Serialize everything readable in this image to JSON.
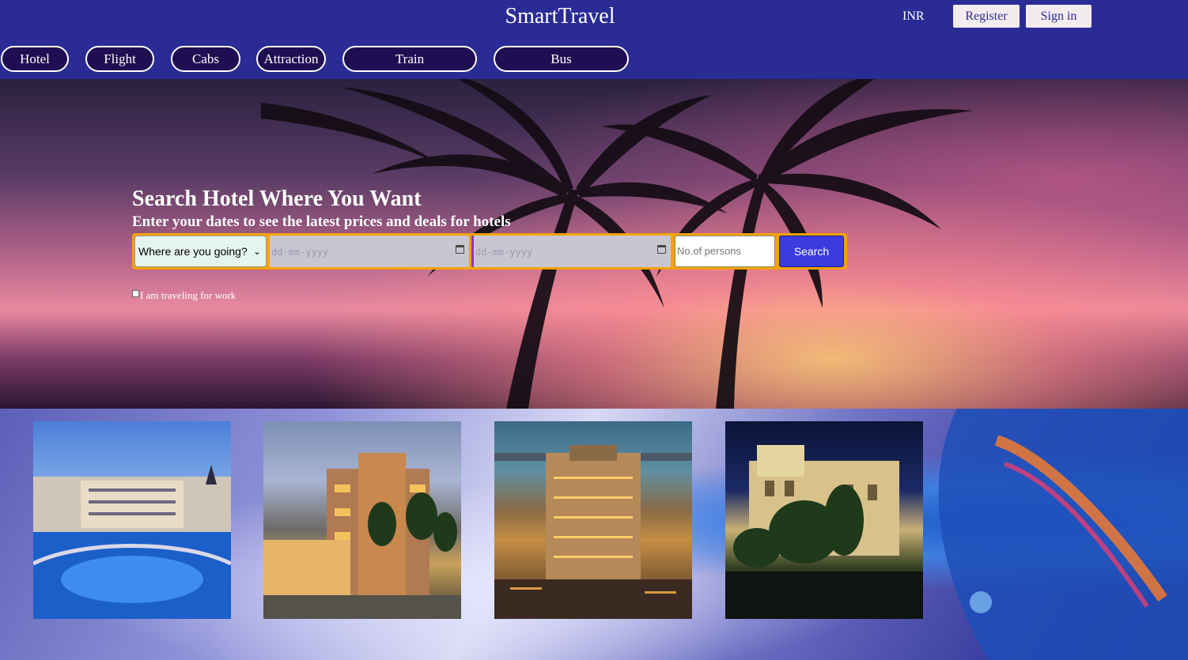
{
  "header": {
    "brand": "SmartTravel",
    "currency": "INR",
    "register_label": "Register",
    "signin_label": "Sign in"
  },
  "nav": {
    "items": [
      {
        "label": "Hotel"
      },
      {
        "label": "Flight"
      },
      {
        "label": "Cabs"
      },
      {
        "label": "Attraction"
      },
      {
        "label": "Train"
      },
      {
        "label": "Bus"
      }
    ]
  },
  "hero": {
    "title": "Search Hotel Where You Want",
    "subtitle": "Enter your dates to see the latest prices and deals for hotels"
  },
  "search": {
    "destination_value": "Where are you going?",
    "checkin_placeholder": "dd-mm-yyyy",
    "checkout_placeholder": "dd-mm-yyyy",
    "persons_placeholder": "No.of persons",
    "button_label": "Search",
    "work_checkbox_label": "I am traveling for work",
    "work_checked": false
  },
  "colors": {
    "header_bg": "#2b2b96",
    "search_border": "#f4a300",
    "search_button": "#3b3be0",
    "nav_pill_bg": "#1f0f52"
  },
  "icons": {
    "destination_dropdown": "chevron-down-icon",
    "date_picker": "calendar-icon"
  }
}
